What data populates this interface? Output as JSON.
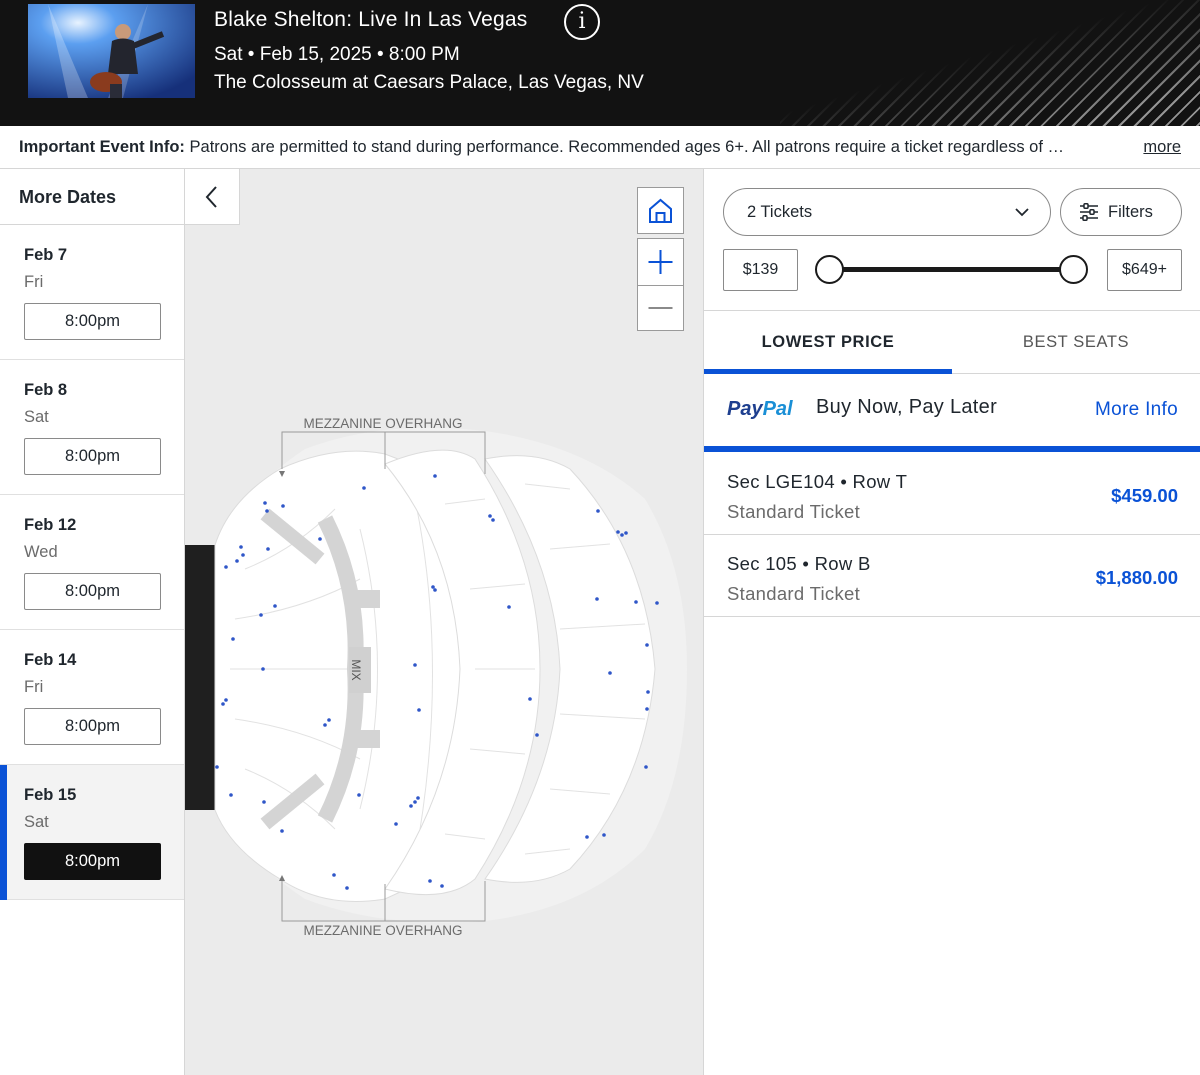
{
  "event": {
    "title": "Blake Shelton: Live In Las Vegas",
    "date_time": "Sat • Feb 15, 2025 • 8:00 PM",
    "venue": "The Colosseum at Caesars Palace, Las Vegas, NV",
    "info_icon": "info-icon"
  },
  "info_bar": {
    "label": "Important Event Info:",
    "text": "Patrons are permitted to stand during performance. Recommended ages 6+. All patrons require a ticket regardless of …",
    "more": "more"
  },
  "sidebar": {
    "title": "More Dates",
    "collapse_icon": "chevron-left-icon",
    "dates": [
      {
        "date": "Feb 7",
        "day": "Fri",
        "time": "8:00pm",
        "selected": false
      },
      {
        "date": "Feb 8",
        "day": "Sat",
        "time": "8:00pm",
        "selected": false
      },
      {
        "date": "Feb 12",
        "day": "Wed",
        "time": "8:00pm",
        "selected": false
      },
      {
        "date": "Feb 14",
        "day": "Fri",
        "time": "8:00pm",
        "selected": false
      },
      {
        "date": "Feb 15",
        "day": "Sat",
        "time": "8:00pm",
        "selected": true
      }
    ]
  },
  "map": {
    "overhang_top": "MEZZANINE OVERHANG",
    "overhang_bottom": "MEZZANINE OVERHANG",
    "mix_label": "MIX",
    "controls": [
      "home-icon",
      "zoom-in-icon",
      "zoom-out-icon"
    ]
  },
  "filters": {
    "quantity": "2 Tickets",
    "filters_label": "Filters",
    "price_min": "$139",
    "price_max": "$649+"
  },
  "tabs": [
    {
      "label": "LOWEST PRICE",
      "active": true
    },
    {
      "label": "BEST SEATS",
      "active": false
    }
  ],
  "paypal": {
    "logo_part1": "Pay",
    "logo_part2": "Pal",
    "text": "Buy Now, Pay Later",
    "more_info": "More Info"
  },
  "listings": [
    {
      "section": "Sec LGE104 • Row T",
      "type": "Standard Ticket",
      "price": "$459.00"
    },
    {
      "section": "Sec 105 • Row B",
      "type": "Standard Ticket",
      "price": "$1,880.00"
    }
  ],
  "colors": {
    "accent": "#0a52d6",
    "header_bg": "#121212",
    "selected_btn": "#111111"
  }
}
